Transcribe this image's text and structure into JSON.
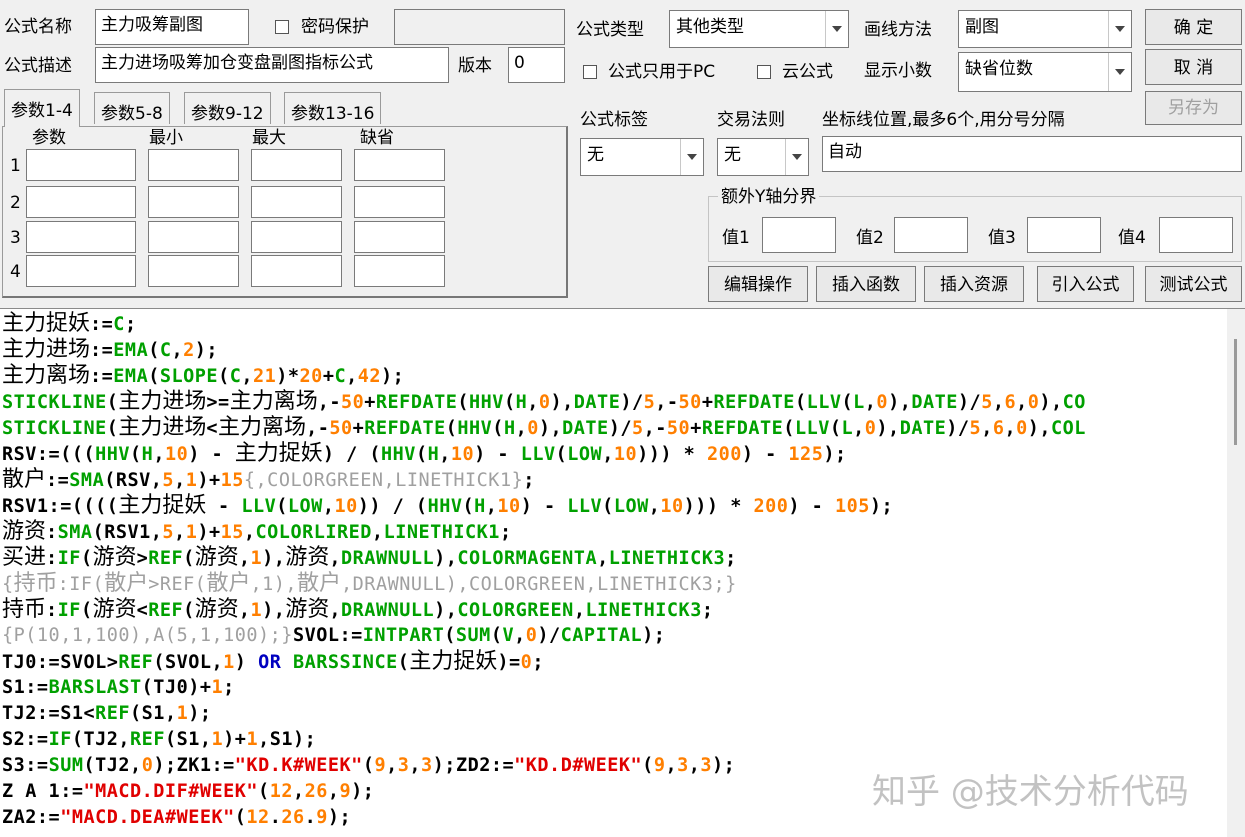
{
  "form": {
    "name_label": "公式名称",
    "name_value": "主力吸筹副图",
    "password_label": "密码保护",
    "password_value": "",
    "desc_label": "公式描述",
    "desc_value": "主力进场吸筹加仓变盘副图指标公式",
    "version_label": "版本",
    "version_value": "0",
    "type_label": "公式类型",
    "type_value": "其他类型",
    "draw_label": "画线方法",
    "draw_value": "副图",
    "pc_only_label": "公式只用于PC",
    "cloud_label": "云公式",
    "decimals_label": "显示小数",
    "decimals_value": "缺省位数",
    "tag_label": "公式标签",
    "tag_value": "无",
    "rule_label": "交易法则",
    "rule_value": "无",
    "axis_label": "坐标线位置,最多6个,用分号分隔",
    "axis_value": "自动",
    "yaxis_group_label": "额外Y轴分界",
    "y_values": [
      "值1",
      "值2",
      "值3",
      "值4"
    ]
  },
  "buttons": {
    "ok": "确  定",
    "cancel": "取  消",
    "save_as": "另存为",
    "edit_ops": "编辑操作",
    "insert_func": "插入函数",
    "insert_res": "插入资源",
    "import_formula": "引入公式",
    "test_formula": "测试公式"
  },
  "params": {
    "tabs": [
      "参数1-4",
      "参数5-8",
      "参数9-12",
      "参数13-16"
    ],
    "headers": [
      "参数",
      "最小",
      "最大",
      "缺省"
    ],
    "rows": [
      "1",
      "2",
      "3",
      "4"
    ]
  },
  "code_lines": [
    [
      [
        "t",
        "主力捉妖"
      ],
      [
        "t",
        ":="
      ],
      [
        "f",
        "C"
      ],
      [
        "t",
        ";"
      ]
    ],
    [
      [
        "t",
        "主力进场"
      ],
      [
        "t",
        ":="
      ],
      [
        "f",
        "EMA"
      ],
      [
        "t",
        "("
      ],
      [
        "f",
        "C"
      ],
      [
        "t",
        ","
      ],
      [
        "n",
        "2"
      ],
      [
        "t",
        ");"
      ]
    ],
    [
      [
        "t",
        "主力离场"
      ],
      [
        "t",
        ":="
      ],
      [
        "f",
        "EMA"
      ],
      [
        "t",
        "("
      ],
      [
        "f",
        "SLOPE"
      ],
      [
        "t",
        "("
      ],
      [
        "f",
        "C"
      ],
      [
        "t",
        ","
      ],
      [
        "n",
        "21"
      ],
      [
        "t",
        ")*"
      ],
      [
        "n",
        "20"
      ],
      [
        "t",
        "+"
      ],
      [
        "f",
        "C"
      ],
      [
        "t",
        ","
      ],
      [
        "n",
        "42"
      ],
      [
        "t",
        ");"
      ]
    ],
    [
      [
        "f",
        "STICKLINE"
      ],
      [
        "t",
        "(主力进场>=主力离场,-"
      ],
      [
        "n",
        "50"
      ],
      [
        "t",
        "+"
      ],
      [
        "f",
        "REFDATE"
      ],
      [
        "t",
        "("
      ],
      [
        "f",
        "HHV"
      ],
      [
        "t",
        "("
      ],
      [
        "f",
        "H"
      ],
      [
        "t",
        ","
      ],
      [
        "n",
        "0"
      ],
      [
        "t",
        "),"
      ],
      [
        "f",
        "DATE"
      ],
      [
        "t",
        ")/"
      ],
      [
        "n",
        "5"
      ],
      [
        "t",
        ",-"
      ],
      [
        "n",
        "50"
      ],
      [
        "t",
        "+"
      ],
      [
        "f",
        "REFDATE"
      ],
      [
        "t",
        "("
      ],
      [
        "f",
        "LLV"
      ],
      [
        "t",
        "("
      ],
      [
        "f",
        "L"
      ],
      [
        "t",
        ","
      ],
      [
        "n",
        "0"
      ],
      [
        "t",
        "),"
      ],
      [
        "f",
        "DATE"
      ],
      [
        "t",
        ")/"
      ],
      [
        "n",
        "5"
      ],
      [
        "t",
        ","
      ],
      [
        "n",
        "6"
      ],
      [
        "t",
        ","
      ],
      [
        "n",
        "0"
      ],
      [
        "t",
        "),"
      ],
      [
        "f",
        "CO"
      ]
    ],
    [
      [
        "f",
        "STICKLINE"
      ],
      [
        "t",
        "(主力进场<主力离场,-"
      ],
      [
        "n",
        "50"
      ],
      [
        "t",
        "+"
      ],
      [
        "f",
        "REFDATE"
      ],
      [
        "t",
        "("
      ],
      [
        "f",
        "HHV"
      ],
      [
        "t",
        "("
      ],
      [
        "f",
        "H"
      ],
      [
        "t",
        ","
      ],
      [
        "n",
        "0"
      ],
      [
        "t",
        "),"
      ],
      [
        "f",
        "DATE"
      ],
      [
        "t",
        ")/"
      ],
      [
        "n",
        "5"
      ],
      [
        "t",
        ",-"
      ],
      [
        "n",
        "50"
      ],
      [
        "t",
        "+"
      ],
      [
        "f",
        "REFDATE"
      ],
      [
        "t",
        "("
      ],
      [
        "f",
        "LLV"
      ],
      [
        "t",
        "("
      ],
      [
        "f",
        "L"
      ],
      [
        "t",
        ","
      ],
      [
        "n",
        "0"
      ],
      [
        "t",
        "),"
      ],
      [
        "f",
        "DATE"
      ],
      [
        "t",
        ")/"
      ],
      [
        "n",
        "5"
      ],
      [
        "t",
        ","
      ],
      [
        "n",
        "6"
      ],
      [
        "t",
        ","
      ],
      [
        "n",
        "0"
      ],
      [
        "t",
        "),"
      ],
      [
        "f",
        "COL"
      ]
    ],
    [
      [
        "t",
        "RSV:=((("
      ],
      [
        "f",
        "HHV"
      ],
      [
        "t",
        "("
      ],
      [
        "f",
        "H"
      ],
      [
        "t",
        ","
      ],
      [
        "n",
        "10"
      ],
      [
        "t",
        ") - 主力捉妖) / ("
      ],
      [
        "f",
        "HHV"
      ],
      [
        "t",
        "("
      ],
      [
        "f",
        "H"
      ],
      [
        "t",
        ","
      ],
      [
        "n",
        "10"
      ],
      [
        "t",
        ") - "
      ],
      [
        "f",
        "LLV"
      ],
      [
        "t",
        "("
      ],
      [
        "f",
        "LOW"
      ],
      [
        "t",
        ","
      ],
      [
        "n",
        "10"
      ],
      [
        "t",
        "))) * "
      ],
      [
        "n",
        "200"
      ],
      [
        "t",
        ") - "
      ],
      [
        "n",
        "125"
      ],
      [
        "t",
        ");"
      ]
    ],
    [
      [
        "t",
        "散户:="
      ],
      [
        "f",
        "SMA"
      ],
      [
        "t",
        "(RSV,"
      ],
      [
        "n",
        "5"
      ],
      [
        "t",
        ","
      ],
      [
        "n",
        "1"
      ],
      [
        "t",
        ")+"
      ],
      [
        "n",
        "15"
      ],
      [
        "c",
        "{,COLORGREEN,LINETHICK1}"
      ],
      [
        "t",
        ";"
      ]
    ],
    [
      [
        "t",
        "RSV1:=((((主力捉妖 - "
      ],
      [
        "f",
        "LLV"
      ],
      [
        "t",
        "("
      ],
      [
        "f",
        "LOW"
      ],
      [
        "t",
        ","
      ],
      [
        "n",
        "10"
      ],
      [
        "t",
        ")) / ("
      ],
      [
        "f",
        "HHV"
      ],
      [
        "t",
        "("
      ],
      [
        "f",
        "H"
      ],
      [
        "t",
        ","
      ],
      [
        "n",
        "10"
      ],
      [
        "t",
        ") - "
      ],
      [
        "f",
        "LLV"
      ],
      [
        "t",
        "("
      ],
      [
        "f",
        "LOW"
      ],
      [
        "t",
        ","
      ],
      [
        "n",
        "10"
      ],
      [
        "t",
        "))) * "
      ],
      [
        "n",
        "200"
      ],
      [
        "t",
        ") - "
      ],
      [
        "n",
        "105"
      ],
      [
        "t",
        ");"
      ]
    ],
    [
      [
        "t",
        "游资:"
      ],
      [
        "f",
        "SMA"
      ],
      [
        "t",
        "(RSV1,"
      ],
      [
        "n",
        "5"
      ],
      [
        "t",
        ","
      ],
      [
        "n",
        "1"
      ],
      [
        "t",
        ")+"
      ],
      [
        "n",
        "15"
      ],
      [
        "t",
        ","
      ],
      [
        "f",
        "COLORLIRED"
      ],
      [
        "t",
        ","
      ],
      [
        "f",
        "LINETHICK1"
      ],
      [
        "t",
        ";"
      ]
    ],
    [
      [
        "t",
        "买进:"
      ],
      [
        "f",
        "IF"
      ],
      [
        "t",
        "(游资>"
      ],
      [
        "f",
        "REF"
      ],
      [
        "t",
        "(游资,"
      ],
      [
        "n",
        "1"
      ],
      [
        "t",
        "),游资,"
      ],
      [
        "f",
        "DRAWNULL"
      ],
      [
        "t",
        "),"
      ],
      [
        "f",
        "COLORMAGENTA"
      ],
      [
        "t",
        ","
      ],
      [
        "f",
        "LINETHICK3"
      ],
      [
        "t",
        ";"
      ]
    ],
    [
      [
        "c",
        "{持币:IF(散户>REF(散户,1),散户,DRAWNULL),COLORGREEN,LINETHICK3;}"
      ]
    ],
    [
      [
        "t",
        "持币:"
      ],
      [
        "f",
        "IF"
      ],
      [
        "t",
        "(游资<"
      ],
      [
        "f",
        "REF"
      ],
      [
        "t",
        "(游资,"
      ],
      [
        "n",
        "1"
      ],
      [
        "t",
        "),游资,"
      ],
      [
        "f",
        "DRAWNULL"
      ],
      [
        "t",
        "),"
      ],
      [
        "f",
        "COLORGREEN"
      ],
      [
        "t",
        ","
      ],
      [
        "f",
        "LINETHICK3"
      ],
      [
        "t",
        ";"
      ]
    ],
    [
      [
        "c",
        "{P(10,1,100),A(5,1,100);}"
      ],
      [
        "t",
        "SVOL:="
      ],
      [
        "f",
        "INTPART"
      ],
      [
        "t",
        "("
      ],
      [
        "f",
        "SUM"
      ],
      [
        "t",
        "("
      ],
      [
        "f",
        "V"
      ],
      [
        "t",
        ","
      ],
      [
        "n",
        "0"
      ],
      [
        "t",
        ")/"
      ],
      [
        "f",
        "CAPITAL"
      ],
      [
        "t",
        ");"
      ]
    ],
    [
      [
        "t",
        "TJ0:=SVOL>"
      ],
      [
        "f",
        "REF"
      ],
      [
        "t",
        "(SVOL,"
      ],
      [
        "n",
        "1"
      ],
      [
        "t",
        ") "
      ],
      [
        "b",
        "OR"
      ],
      [
        "t",
        " "
      ],
      [
        "f",
        "BARSSINCE"
      ],
      [
        "t",
        "(主力捉妖)="
      ],
      [
        "n",
        "0"
      ],
      [
        "t",
        ";"
      ]
    ],
    [
      [
        "t",
        "S1:="
      ],
      [
        "f",
        "BARSLAST"
      ],
      [
        "t",
        "(TJ0)+"
      ],
      [
        "n",
        "1"
      ],
      [
        "t",
        ";"
      ]
    ],
    [
      [
        "t",
        "TJ2:=S1<"
      ],
      [
        "f",
        "REF"
      ],
      [
        "t",
        "(S1,"
      ],
      [
        "n",
        "1"
      ],
      [
        "t",
        ");"
      ]
    ],
    [
      [
        "t",
        "S2:="
      ],
      [
        "f",
        "IF"
      ],
      [
        "t",
        "(TJ2,"
      ],
      [
        "f",
        "REF"
      ],
      [
        "t",
        "(S1,"
      ],
      [
        "n",
        "1"
      ],
      [
        "t",
        ")+"
      ],
      [
        "n",
        "1"
      ],
      [
        "t",
        ",S1);"
      ]
    ],
    [
      [
        "t",
        "S3:="
      ],
      [
        "f",
        "SUM"
      ],
      [
        "t",
        "(TJ2,"
      ],
      [
        "n",
        "0"
      ],
      [
        "t",
        ");ZK1:="
      ],
      [
        "s",
        "\"KD.K#WEEK\""
      ],
      [
        "t",
        "("
      ],
      [
        "n",
        "9"
      ],
      [
        "t",
        ","
      ],
      [
        "n",
        "3"
      ],
      [
        "t",
        ","
      ],
      [
        "n",
        "3"
      ],
      [
        "t",
        ");ZD2:="
      ],
      [
        "s",
        "\"KD.D#WEEK\""
      ],
      [
        "t",
        "("
      ],
      [
        "n",
        "9"
      ],
      [
        "t",
        ","
      ],
      [
        "n",
        "3"
      ],
      [
        "t",
        ","
      ],
      [
        "n",
        "3"
      ],
      [
        "t",
        ");"
      ]
    ],
    [
      [
        "t",
        "Z A 1:="
      ],
      [
        "s",
        "\"MACD.DIF#WEEK\""
      ],
      [
        "t",
        "("
      ],
      [
        "n",
        "12"
      ],
      [
        "t",
        ","
      ],
      [
        "n",
        "26"
      ],
      [
        "t",
        ","
      ],
      [
        "n",
        "9"
      ],
      [
        "t",
        ");"
      ]
    ],
    [
      [
        "t",
        "ZA2:="
      ],
      [
        "s",
        "\"MACD.DEA#WEEK\""
      ],
      [
        "t",
        "("
      ],
      [
        "n",
        "12"
      ],
      [
        "t",
        "."
      ],
      [
        "n",
        "26"
      ],
      [
        "t",
        "."
      ],
      [
        "n",
        "9"
      ],
      [
        "t",
        ");"
      ]
    ]
  ],
  "watermark": "知乎 @技术分析代码"
}
